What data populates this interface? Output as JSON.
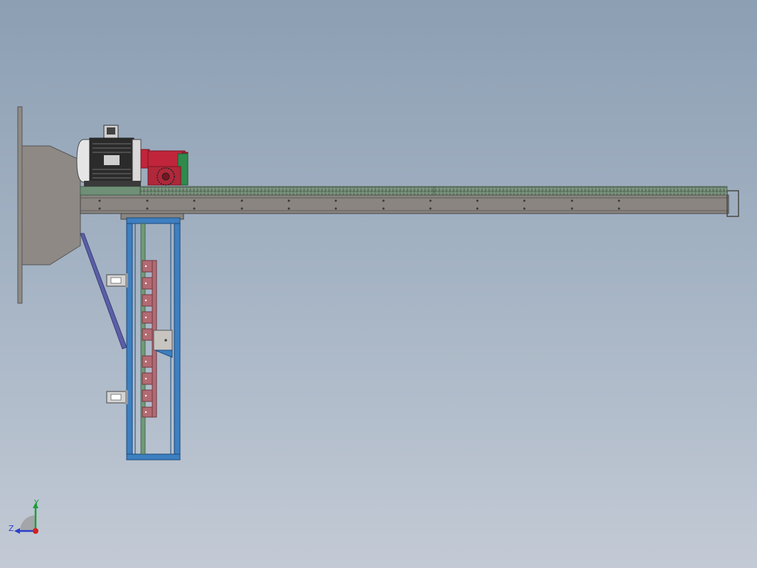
{
  "viewport": {
    "background_top": "#8c9fb3",
    "background_bottom": "#c3cad5"
  },
  "model": {
    "colors": {
      "wall_plate": "#8f8a85",
      "hopper": "#8e8984",
      "rail_beam": "#8a8580",
      "rack": "#6f8f77",
      "motor_body": "#d9d9d9",
      "motor_fins": "#2b2b2b",
      "gearbox": "#c0253b",
      "gear": "#b0283a",
      "gear_mount": "#2f8a4c",
      "frame": "#3d7fc0",
      "brace": "#5b5fa6",
      "blocks": "#b36b73",
      "cylinder": "#bdbdbd"
    }
  },
  "triad": {
    "y_label": "Y",
    "z_label": "Z",
    "y_color": "#1f9d3a",
    "z_color": "#2b3fc8",
    "x_color": "#d02020"
  }
}
